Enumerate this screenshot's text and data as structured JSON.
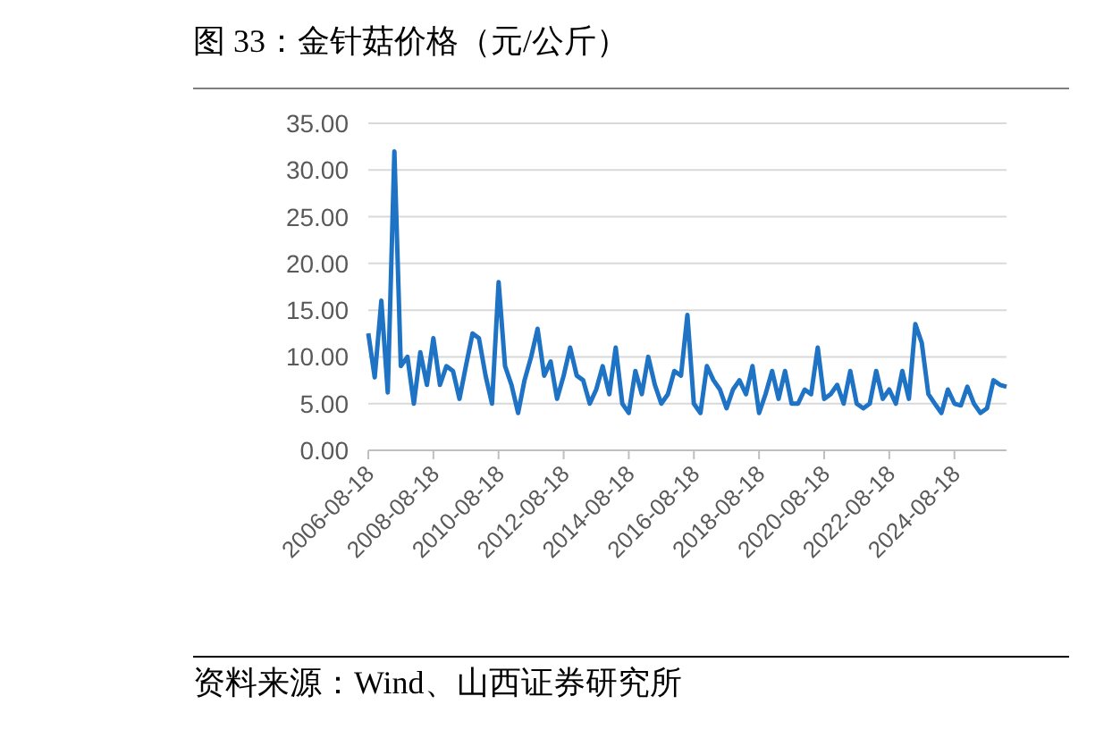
{
  "figure": {
    "title": "图 33：金针菇价格（元/公斤）",
    "chart_data": {
      "type": "line",
      "categories": [
        "2006-08-18",
        null,
        null,
        null,
        null,
        null,
        null,
        null,
        null,
        null,
        "2008-08-18",
        null,
        null,
        null,
        null,
        null,
        null,
        null,
        null,
        null,
        "2010-08-18",
        null,
        null,
        null,
        null,
        null,
        null,
        null,
        null,
        null,
        "2012-08-18",
        null,
        null,
        null,
        null,
        null,
        null,
        null,
        null,
        null,
        "2014-08-18",
        null,
        null,
        null,
        null,
        null,
        null,
        null,
        null,
        null,
        "2016-08-18",
        null,
        null,
        null,
        null,
        null,
        null,
        null,
        null,
        null,
        "2018-08-18",
        null,
        null,
        null,
        null,
        null,
        null,
        null,
        null,
        null,
        "2020-08-18",
        null,
        null,
        null,
        null,
        null,
        null,
        null,
        null,
        null,
        "2022-08-18",
        null,
        null,
        null,
        null,
        null,
        null,
        null,
        null,
        null,
        "2024-08-18",
        null,
        null,
        null,
        null,
        null,
        null,
        null,
        null
      ],
      "series": [
        {
          "color": "#1f73c4",
          "values": [
            12.5,
            7.8,
            16,
            6.2,
            32,
            9,
            10,
            5,
            10.5,
            7,
            12,
            7,
            9,
            8.5,
            5.5,
            9,
            12.5,
            12,
            8,
            5,
            18,
            9,
            7,
            4,
            7.5,
            10,
            13,
            8,
            9.5,
            5.5,
            8,
            11,
            8,
            7.5,
            5,
            6.5,
            9,
            6,
            11,
            5,
            4,
            8.5,
            6,
            10,
            7,
            5,
            6,
            8.5,
            8,
            14.5,
            5,
            4,
            9,
            7.5,
            6.5,
            4.5,
            6.5,
            7.5,
            6,
            9,
            4,
            6,
            8.5,
            5.5,
            8.5,
            5,
            5,
            6.5,
            6,
            11,
            5.5,
            6,
            7,
            5,
            8.5,
            5,
            4.5,
            5,
            8.5,
            5.5,
            6.5,
            5,
            8.5,
            5.5,
            13.5,
            11.5,
            6,
            5,
            4,
            6.5,
            5,
            4.8,
            6.8,
            5,
            4,
            4.5,
            7.5,
            7,
            6.8
          ]
        }
      ],
      "ylim": [
        0,
        35
      ],
      "grid": true,
      "yticks": [
        {
          "value": 0,
          "label": "0.00"
        },
        {
          "value": 5,
          "label": "5.00"
        },
        {
          "value": 10,
          "label": "10.00"
        },
        {
          "value": 15,
          "label": "15.00"
        },
        {
          "value": 20,
          "label": "20.00"
        },
        {
          "value": 25,
          "label": "25.00"
        },
        {
          "value": 30,
          "label": "30.00"
        },
        {
          "value": 35,
          "label": "35.00"
        }
      ]
    },
    "source": "资料来源：Wind、山西证券研究所"
  }
}
